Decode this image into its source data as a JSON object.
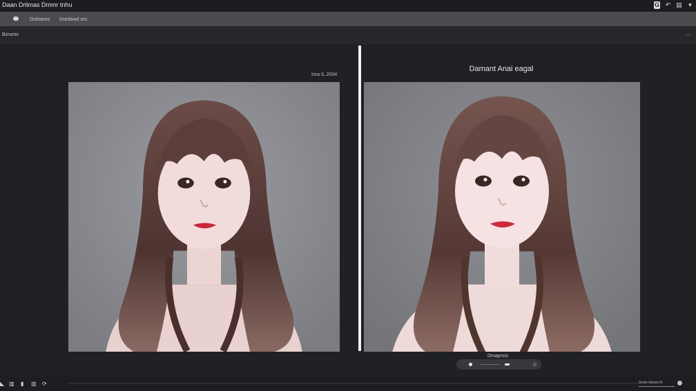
{
  "window": {
    "title": "Daan Drlimas Dmmr tnhu",
    "controls": [
      {
        "name": "app-badge-icon",
        "glyph": "G"
      },
      {
        "name": "undo-icon",
        "glyph": "↶"
      },
      {
        "name": "save-icon",
        "glyph": "▤"
      },
      {
        "name": "filter-icon",
        "glyph": "▾"
      }
    ]
  },
  "toolbar": {
    "icon": "chat-bubble-icon",
    "items": [
      "Drdowsrs",
      "Irsedawd ors"
    ]
  },
  "panel": {
    "label": "Bzrums"
  },
  "left_pane": {
    "caption": "Inra IL 2004"
  },
  "right_pane": {
    "title": "Damant Anai eagal"
  },
  "status": {
    "text": "Dmaprsts"
  },
  "bottom_bar": {
    "icons": [
      {
        "name": "pointer-icon",
        "glyph": "◣"
      },
      {
        "name": "columns-icon",
        "glyph": "▥"
      },
      {
        "name": "layers-icon",
        "glyph": "▮"
      },
      {
        "name": "refresh-icon",
        "glyph": "⟳"
      }
    ],
    "field": "Soulo tdsans ttr"
  },
  "colors": {
    "background": "#202124",
    "toolbar": "#4a4b4f",
    "splitter": "#f2f2f2",
    "photo_backdrop": "#8c8d92",
    "hair": "#5a3d3a",
    "skin": "#f0dada",
    "lips": "#c8283a"
  }
}
